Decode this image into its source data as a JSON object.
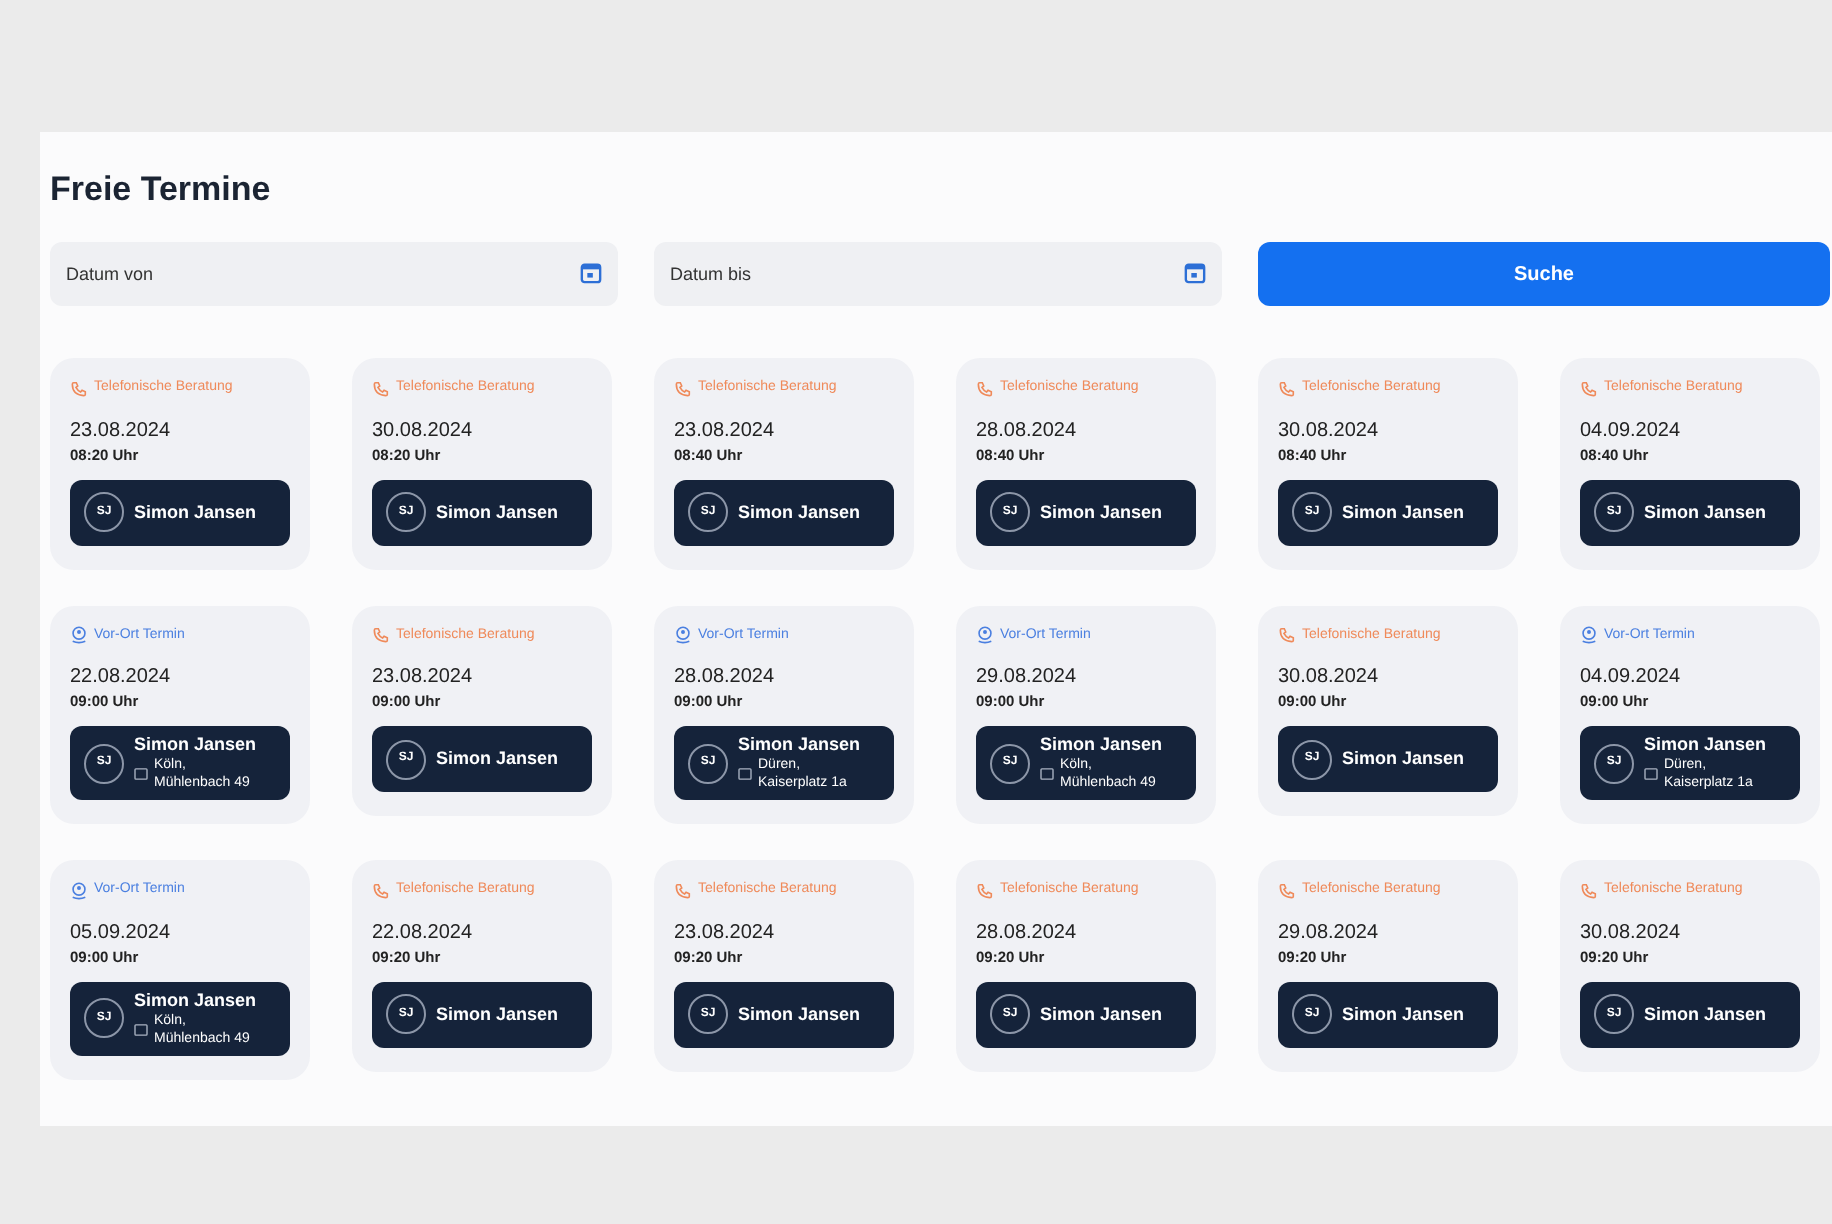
{
  "title": "Freie Termine",
  "filters": [
    {
      "placeholder": "Datum von"
    },
    {
      "placeholder": "Datum bis"
    }
  ],
  "search_button": "Suche",
  "appointments": [
    {
      "kind": "phone",
      "type_label": "Telefonische Beratung",
      "date": "23.08.2024",
      "time": "08:20 Uhr",
      "initials": "SJ",
      "advisor": "Simon Jansen"
    },
    {
      "kind": "phone",
      "type_label": "Telefonische Beratung",
      "date": "30.08.2024",
      "time": "08:20 Uhr",
      "initials": "SJ",
      "advisor": "Simon Jansen"
    },
    {
      "kind": "phone",
      "type_label": "Telefonische Beratung",
      "date": "23.08.2024",
      "time": "08:40 Uhr",
      "initials": "SJ",
      "advisor": "Simon Jansen"
    },
    {
      "kind": "phone",
      "type_label": "Telefonische Beratung",
      "date": "28.08.2024",
      "time": "08:40 Uhr",
      "initials": "SJ",
      "advisor": "Simon Jansen"
    },
    {
      "kind": "phone",
      "type_label": "Telefonische Beratung",
      "date": "30.08.2024",
      "time": "08:40 Uhr",
      "initials": "SJ",
      "advisor": "Simon Jansen"
    },
    {
      "kind": "phone",
      "type_label": "Telefonische Beratung",
      "date": "04.09.2024",
      "time": "08:40 Uhr",
      "initials": "SJ",
      "advisor": "Simon Jansen"
    },
    {
      "kind": "onsite",
      "type_label": "Vor-Ort Termin",
      "date": "22.08.2024",
      "time": "09:00 Uhr",
      "initials": "SJ",
      "advisor": "Simon Jansen",
      "location": "Köln, Mühlenbach 49"
    },
    {
      "kind": "phone",
      "type_label": "Telefonische Beratung",
      "date": "23.08.2024",
      "time": "09:00 Uhr",
      "initials": "SJ",
      "advisor": "Simon Jansen"
    },
    {
      "kind": "onsite",
      "type_label": "Vor-Ort Termin",
      "date": "28.08.2024",
      "time": "09:00 Uhr",
      "initials": "SJ",
      "advisor": "Simon Jansen",
      "location": "Düren, Kaiserplatz 1a"
    },
    {
      "kind": "onsite",
      "type_label": "Vor-Ort Termin",
      "date": "29.08.2024",
      "time": "09:00 Uhr",
      "initials": "SJ",
      "advisor": "Simon Jansen",
      "location": "Köln, Mühlenbach 49"
    },
    {
      "kind": "phone",
      "type_label": "Telefonische Beratung",
      "date": "30.08.2024",
      "time": "09:00 Uhr",
      "initials": "SJ",
      "advisor": "Simon Jansen"
    },
    {
      "kind": "onsite",
      "type_label": "Vor-Ort Termin",
      "date": "04.09.2024",
      "time": "09:00 Uhr",
      "initials": "SJ",
      "advisor": "Simon Jansen",
      "location": "Düren, Kaiserplatz 1a"
    },
    {
      "kind": "onsite",
      "type_label": "Vor-Ort Termin",
      "date": "05.09.2024",
      "time": "09:00 Uhr",
      "initials": "SJ",
      "advisor": "Simon Jansen",
      "location": "Köln, Mühlenbach 49"
    },
    {
      "kind": "phone",
      "type_label": "Telefonische Beratung",
      "date": "22.08.2024",
      "time": "09:20 Uhr",
      "initials": "SJ",
      "advisor": "Simon Jansen"
    },
    {
      "kind": "phone",
      "type_label": "Telefonische Beratung",
      "date": "23.08.2024",
      "time": "09:20 Uhr",
      "initials": "SJ",
      "advisor": "Simon Jansen"
    },
    {
      "kind": "phone",
      "type_label": "Telefonische Beratung",
      "date": "28.08.2024",
      "time": "09:20 Uhr",
      "initials": "SJ",
      "advisor": "Simon Jansen"
    },
    {
      "kind": "phone",
      "type_label": "Telefonische Beratung",
      "date": "29.08.2024",
      "time": "09:20 Uhr",
      "initials": "SJ",
      "advisor": "Simon Jansen"
    },
    {
      "kind": "phone",
      "type_label": "Telefonische Beratung",
      "date": "30.08.2024",
      "time": "09:20 Uhr",
      "initials": "SJ",
      "advisor": "Simon Jansen"
    }
  ]
}
